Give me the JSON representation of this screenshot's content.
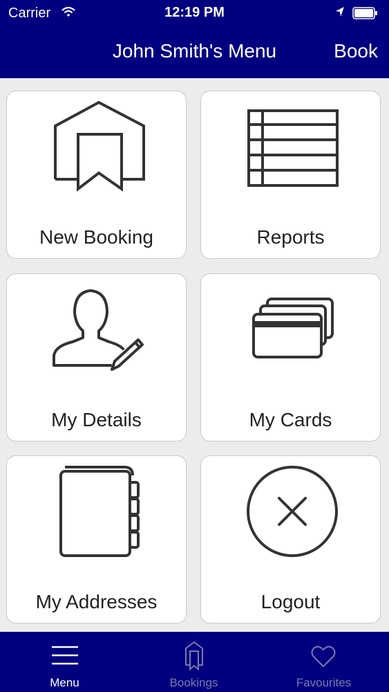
{
  "status_bar": {
    "carrier": "Carrier",
    "time": "12:19 PM"
  },
  "nav": {
    "title": "John Smith's Menu",
    "right_button": "Book"
  },
  "tiles": [
    {
      "label": "New Booking",
      "icon": "house-bookmark-icon"
    },
    {
      "label": "Reports",
      "icon": "report-list-icon"
    },
    {
      "label": "My Details",
      "icon": "user-edit-icon"
    },
    {
      "label": "My Cards",
      "icon": "cards-icon"
    },
    {
      "label": "My Addresses",
      "icon": "address-book-icon"
    },
    {
      "label": "Logout",
      "icon": "close-circle-icon"
    }
  ],
  "tabs": [
    {
      "label": "Menu",
      "icon": "menu-icon",
      "active": true
    },
    {
      "label": "Bookings",
      "icon": "bookings-icon",
      "active": false
    },
    {
      "label": "Favourites",
      "icon": "heart-icon",
      "active": false
    }
  ],
  "colors": {
    "brand": "#000080",
    "background": "#ececec",
    "icon_stroke": "#333333",
    "tab_inactive": "#7a7aa8"
  }
}
